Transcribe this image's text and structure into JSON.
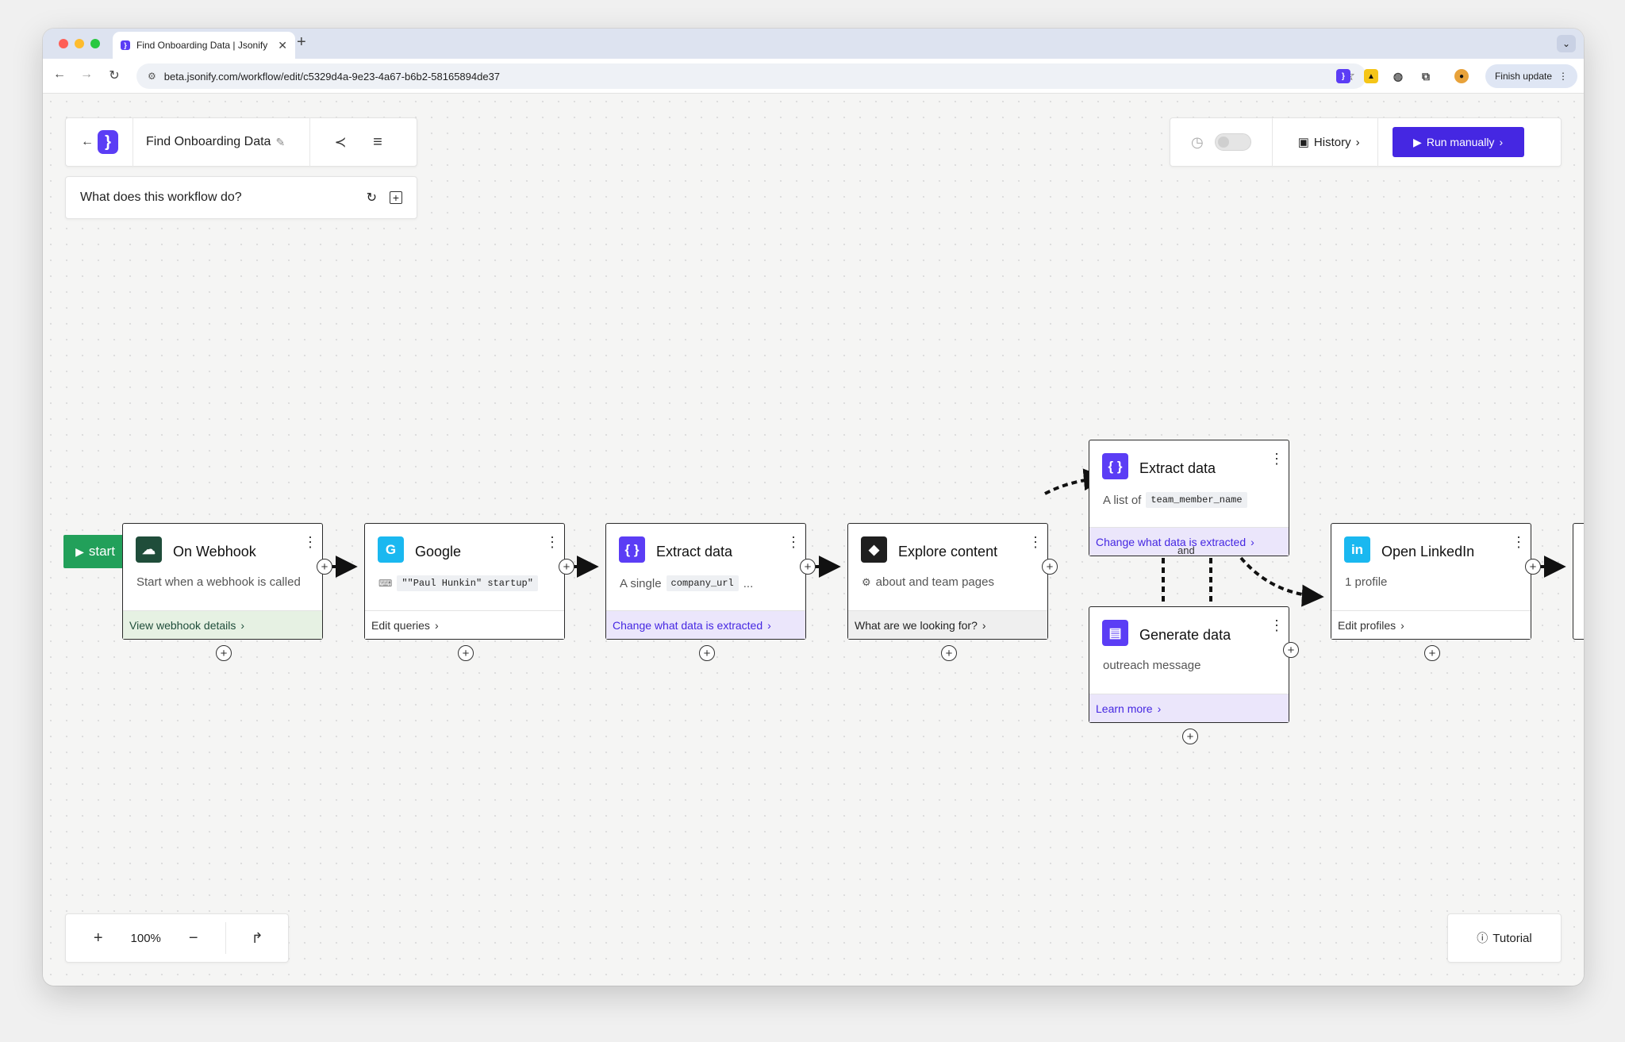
{
  "browser": {
    "tab_title": "Find Onboarding Data | Jsonify",
    "url": "beta.jsonify.com/workflow/edit/c5329d4a-9e23-4a67-b6b2-58165894de37",
    "finish_update": "Finish update"
  },
  "header": {
    "workflow_name": "Find Onboarding Data",
    "question": "What does this workflow do?"
  },
  "controls": {
    "history": "History",
    "run_manually": "Run manually"
  },
  "start_label": "start",
  "nodes": [
    {
      "title": "On Webhook",
      "subtitle": "Start when a webhook is called",
      "footer": "View webhook details"
    },
    {
      "title": "Google",
      "code": "\"\"Paul Hunkin\" startup\"",
      "footer": "Edit queries"
    },
    {
      "title": "Extract data",
      "prefix": "A single",
      "code": "company_url",
      "suffix": "...",
      "footer": "Change what data is extracted"
    },
    {
      "title": "Explore content",
      "subtitle": "about and team pages",
      "footer": "What are we looking for?"
    },
    {
      "title": "Extract data",
      "prefix": "A list of",
      "code": "team_member_name",
      "footer": "Change what data is extracted"
    },
    {
      "title": "Generate data",
      "subtitle": "outreach message",
      "footer": "Learn more"
    },
    {
      "title": "Open LinkedIn",
      "subtitle": "1 profile",
      "footer": "Edit profiles"
    }
  ],
  "and_label": "and",
  "zoom": {
    "level": "100%"
  },
  "tutorial": "Tutorial",
  "colors": {
    "brand": "#5b3df5",
    "run_button": "#4527e2",
    "start": "#22a05a",
    "webhook_icon": "#1f4d3a",
    "google_icon": "#1ab8f0",
    "linkedin_icon": "#1ab8f0",
    "green_footer": "#e6f1e3",
    "purple_footer": "#ebe6fb"
  }
}
